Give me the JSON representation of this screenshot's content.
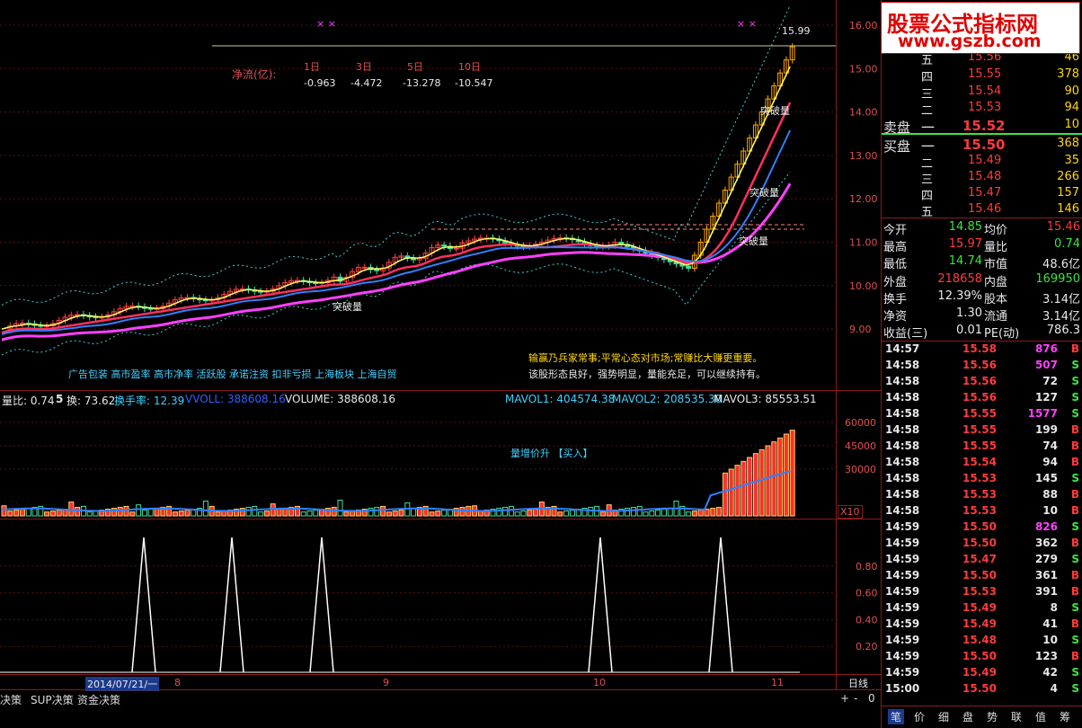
{
  "watermark": {
    "line1": "股票公式指标网",
    "line2": "www.gszb.com"
  },
  "main_chart": {
    "netflow_label": "净流(亿):",
    "periods": [
      "1日",
      "3日",
      "5日",
      "10日"
    ],
    "netflows": [
      "-0.963",
      "-4.472",
      "-13.278",
      "-10.547"
    ],
    "top_price_label": "15.99",
    "marks": "× ×",
    "breakout_label": "突破量",
    "price_axis": [
      "16.00",
      "15.00",
      "14.00",
      "13.00",
      "12.00",
      "11.00",
      "10.00",
      "9.00"
    ],
    "ad_line": "广告包装 高市盈率 高市净率 活跃股 承诺注资 扣非亏损 上海板块 上海自贸",
    "comment1": "输赢乃兵家常事;平常心态对市场;常赚比大赚更重要。",
    "comment2": "该股形态良好，强势明显，量能充足，可以继续持有。"
  },
  "volume_panel": {
    "header": {
      "liangbi": "量比: 0.74",
      "period": "5",
      "huan": "换: 73.62",
      "turnover": "换手率: 12.39",
      "voll": "VVOLL: 388608.16",
      "volume": "VOLUME: 388608.16",
      "mavol1": "MAVOL1: 404574.38",
      "mavol2": "MAVOL2: 208535.30",
      "mavol3": "MAVOL3: 85553.51"
    },
    "signal": "量增价升 【买入】",
    "axis": [
      "60000",
      "45000",
      "30000"
    ],
    "unit": "X10"
  },
  "indicator_panel": {
    "axis": [
      "0.80",
      "0.60",
      "0.40",
      "0.20"
    ]
  },
  "date_axis": {
    "current": "2014/07/21/一",
    "months": [
      "8",
      "9",
      "10",
      "11"
    ],
    "period_label": "日线"
  },
  "bottom_tabs": [
    "决策",
    "SUP决策",
    "资金决策"
  ],
  "zoom_buttons": [
    "+",
    "-",
    "0"
  ],
  "orderbook": {
    "sell_label": "卖盘",
    "buy_label": "买盘",
    "asks": [
      {
        "level": "五",
        "price": "15.56",
        "vol": "46"
      },
      {
        "level": "四",
        "price": "15.55",
        "vol": "378"
      },
      {
        "level": "三",
        "price": "15.54",
        "vol": "90"
      },
      {
        "level": "二",
        "price": "15.53",
        "vol": "94"
      },
      {
        "level": "一",
        "price": "15.52",
        "vol": "10"
      }
    ],
    "bids": [
      {
        "level": "一",
        "price": "15.50",
        "vol": "368"
      },
      {
        "level": "二",
        "price": "15.49",
        "vol": "35"
      },
      {
        "level": "三",
        "price": "15.48",
        "vol": "266"
      },
      {
        "level": "四",
        "price": "15.47",
        "vol": "157"
      },
      {
        "level": "五",
        "price": "15.46",
        "vol": "146"
      }
    ]
  },
  "stats": [
    {
      "l1": "今开",
      "v1": "14.85",
      "c1": "green",
      "l2": "均价",
      "v2": "15.46",
      "c2": "red"
    },
    {
      "l1": "最高",
      "v1": "15.97",
      "c1": "red",
      "l2": "量比",
      "v2": "0.74",
      "c2": "green"
    },
    {
      "l1": "最低",
      "v1": "14.74",
      "c1": "green",
      "l2": "市值",
      "v2": "48.6亿",
      "c2": "white"
    },
    {
      "l1": "外盘",
      "v1": "218658",
      "c1": "red",
      "l2": "内盘",
      "v2": "169950",
      "c2": "green"
    },
    {
      "l1": "换手",
      "v1": "12.39%",
      "c1": "white",
      "l2": "股本",
      "v2": "3.14亿",
      "c2": "white"
    },
    {
      "l1": "净资",
      "v1": "1.30",
      "c1": "white",
      "l2": "流通",
      "v2": "3.14亿",
      "c2": "white"
    },
    {
      "l1": "收益(三)",
      "v1": "0.01",
      "c1": "white",
      "l2": "PE(动)",
      "v2": "786.3",
      "c2": "white"
    }
  ],
  "ticks": [
    {
      "t": "14:57",
      "p": "15.58",
      "v": "876",
      "s": "B",
      "vc": "magenta"
    },
    {
      "t": "14:58",
      "p": "15.56",
      "v": "507",
      "s": "S",
      "vc": "magenta"
    },
    {
      "t": "14:58",
      "p": "15.56",
      "v": "72",
      "s": "S",
      "vc": "white"
    },
    {
      "t": "14:58",
      "p": "15.56",
      "v": "127",
      "s": "S",
      "vc": "white"
    },
    {
      "t": "14:58",
      "p": "15.55",
      "v": "1577",
      "s": "S",
      "vc": "magenta"
    },
    {
      "t": "14:58",
      "p": "15.55",
      "v": "199",
      "s": "B",
      "vc": "white"
    },
    {
      "t": "14:58",
      "p": "15.55",
      "v": "74",
      "s": "B",
      "vc": "white"
    },
    {
      "t": "14:58",
      "p": "15.54",
      "v": "94",
      "s": "B",
      "vc": "white"
    },
    {
      "t": "14:58",
      "p": "15.53",
      "v": "145",
      "s": "S",
      "vc": "white"
    },
    {
      "t": "14:58",
      "p": "15.53",
      "v": "88",
      "s": "B",
      "vc": "white"
    },
    {
      "t": "14:58",
      "p": "15.53",
      "v": "10",
      "s": "B",
      "vc": "white"
    },
    {
      "t": "14:59",
      "p": "15.50",
      "v": "826",
      "s": "S",
      "vc": "magenta"
    },
    {
      "t": "14:59",
      "p": "15.50",
      "v": "362",
      "s": "B",
      "vc": "white"
    },
    {
      "t": "14:59",
      "p": "15.47",
      "v": "279",
      "s": "S",
      "vc": "white"
    },
    {
      "t": "14:59",
      "p": "15.50",
      "v": "361",
      "s": "B",
      "vc": "white"
    },
    {
      "t": "14:59",
      "p": "15.53",
      "v": "391",
      "s": "B",
      "vc": "white"
    },
    {
      "t": "14:59",
      "p": "15.49",
      "v": "8",
      "s": "S",
      "vc": "white"
    },
    {
      "t": "14:59",
      "p": "15.49",
      "v": "41",
      "s": "B",
      "vc": "white"
    },
    {
      "t": "14:59",
      "p": "15.48",
      "v": "10",
      "s": "S",
      "vc": "white"
    },
    {
      "t": "14:59",
      "p": "15.50",
      "v": "123",
      "s": "B",
      "vc": "white"
    },
    {
      "t": "14:59",
      "p": "15.49",
      "v": "42",
      "s": "S",
      "vc": "white"
    },
    {
      "t": "15:00",
      "p": "15.50",
      "v": "4",
      "s": "S",
      "vc": "white"
    }
  ],
  "right_tabs": [
    "笔",
    "价",
    "细",
    "盘",
    "势",
    "联",
    "值",
    "筹"
  ]
}
